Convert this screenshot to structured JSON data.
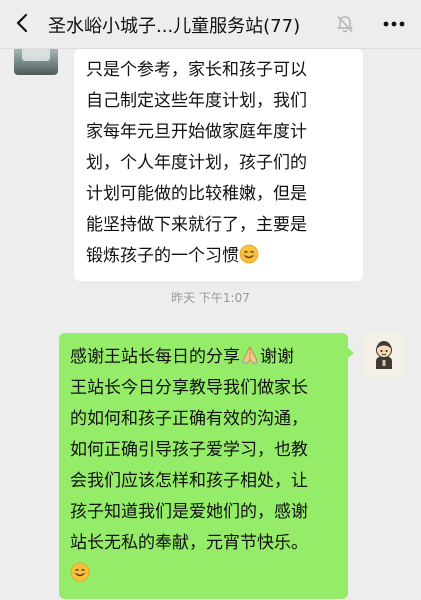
{
  "header": {
    "title": "圣水峪小城子...儿童服务站(77)",
    "back_icon": "chevron-left-icon",
    "mute_icon": "bell-muted-icon",
    "more_icon": "more-dots-icon"
  },
  "messages": [
    {
      "side": "left",
      "text_before_emoji": "只是个参考，家长和孩子可以\n自己制定这些年度计划，我们\n家每年元旦开始做家庭年度计\n划，个人年度计划，孩子们的\n计划可能做的比较稚嫩，但是\n能坚持做下来就行了，主要是\n锻炼孩子的一个习惯",
      "emoji": "smiling-face-emoji"
    },
    {
      "side": "right",
      "text_part1": "感谢王站长每日的分享",
      "emoji1": "praying-hands-emoji",
      "text_part2": "谢谢\n王站长今日分享教导我们做家长\n的如何和孩子正确有效的沟通，\n如何正确引导孩子爱学习，也教\n会我们应该怎样和孩子相处，让\n孩子知道我们是爱她们的，感谢\n站长无私的奉献，元宵节快乐。\n",
      "emoji2": "smiling-face-emoji"
    }
  ],
  "timestamp": "昨天 下午1:07",
  "colors": {
    "background": "#ededed",
    "bubble_self": "#95ec69",
    "bubble_other": "#ffffff"
  }
}
